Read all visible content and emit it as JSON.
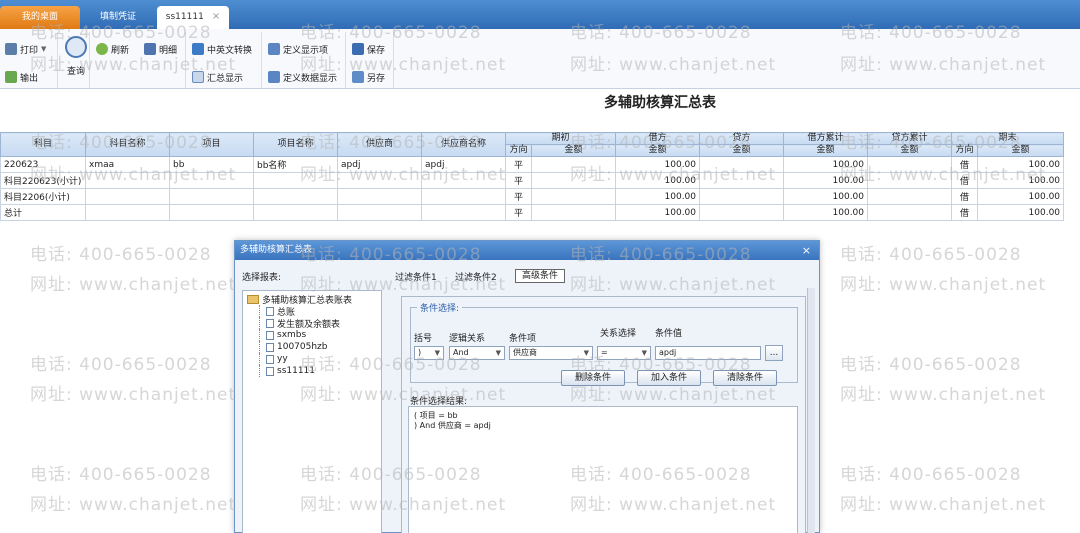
{
  "tabs": [
    {
      "label": "我的桌面"
    },
    {
      "label": "填制凭证"
    },
    {
      "label": "ss11111",
      "close": "×"
    }
  ],
  "toolbar": {
    "print": "打印",
    "export": "输出",
    "query": "查询",
    "refresh": "刷新",
    "detail": "明细",
    "lang_switch": "中英文转换",
    "summary_display": "汇总显示",
    "define_display_items": "定义显示项",
    "define_data_display": "定义数据显示",
    "save": "保存",
    "save_as": "另存"
  },
  "report": {
    "title": "多辅助核算汇总表"
  },
  "table": {
    "headers": {
      "subject": "科目",
      "subject_name": "科目名称",
      "project": "项目",
      "project_name": "项目名称",
      "supplier": "供应商",
      "supplier_name": "供应商名称",
      "opening": "期初",
      "debit": "借方",
      "credit": "贷方",
      "debit_cum": "借方累计",
      "credit_cum": "贷方累计",
      "closing": "期末",
      "direction": "方向",
      "amount": "金额"
    },
    "rows": [
      {
        "subject": "220623",
        "subject_name": "xmaa",
        "project": "bb",
        "project_name": "bb名称",
        "supplier": "apdj",
        "supplier_name": "apdj",
        "open_dir": "平",
        "open_amt": "",
        "debit": "100.00",
        "credit": "",
        "debit_cum": "100.00",
        "credit_cum": "",
        "close_dir": "借",
        "close_amt": "100.00"
      },
      {
        "subject": "科目220623(小计)",
        "subject_name": "",
        "project": "",
        "project_name": "",
        "supplier": "",
        "supplier_name": "",
        "open_dir": "平",
        "open_amt": "",
        "debit": "100.00",
        "credit": "",
        "debit_cum": "100.00",
        "credit_cum": "",
        "close_dir": "借",
        "close_amt": "100.00"
      },
      {
        "subject": "科目2206(小计)",
        "subject_name": "",
        "project": "",
        "project_name": "",
        "supplier": "",
        "supplier_name": "",
        "open_dir": "平",
        "open_amt": "",
        "debit": "100.00",
        "credit": "",
        "debit_cum": "100.00",
        "credit_cum": "",
        "close_dir": "借",
        "close_amt": "100.00"
      },
      {
        "subject": "总计",
        "subject_name": "",
        "project": "",
        "project_name": "",
        "supplier": "",
        "supplier_name": "",
        "open_dir": "平",
        "open_amt": "",
        "debit": "100.00",
        "credit": "",
        "debit_cum": "100.00",
        "credit_cum": "",
        "close_dir": "借",
        "close_amt": "100.00"
      }
    ]
  },
  "dialog": {
    "title": "多辅助核算汇总表",
    "close": "×",
    "select_report_label": "选择报表:",
    "tree_root": "多辅助核算汇总表账表",
    "tree_items": [
      "总账",
      "发生额及余额表",
      "sxmbs",
      "100705hzb",
      "yy",
      "ss11111"
    ],
    "subtabs": [
      "过滤条件1",
      "过滤条件2",
      "高级条件"
    ],
    "condition_legend": "条件选择:",
    "col_labels": {
      "bracket": "括号",
      "logic": "逻辑关系",
      "item": "条件项",
      "relation": "关系选择",
      "value": "条件值"
    },
    "values": {
      "bracket": ")",
      "logic": "And",
      "item": "供应商",
      "relation": "=",
      "value": "apdj"
    },
    "ellipsis": "...",
    "buttons": {
      "delete": "删除条件",
      "add": "加入条件",
      "clear": "清除条件"
    },
    "result_label": "条件选择结果:",
    "result_lines": [
      "(    项目 = bb",
      ") And 供应商 = apdj"
    ]
  },
  "watermark": {
    "phone": "电话: 400-665-0028",
    "site": "网址: www.chanjet.net"
  }
}
